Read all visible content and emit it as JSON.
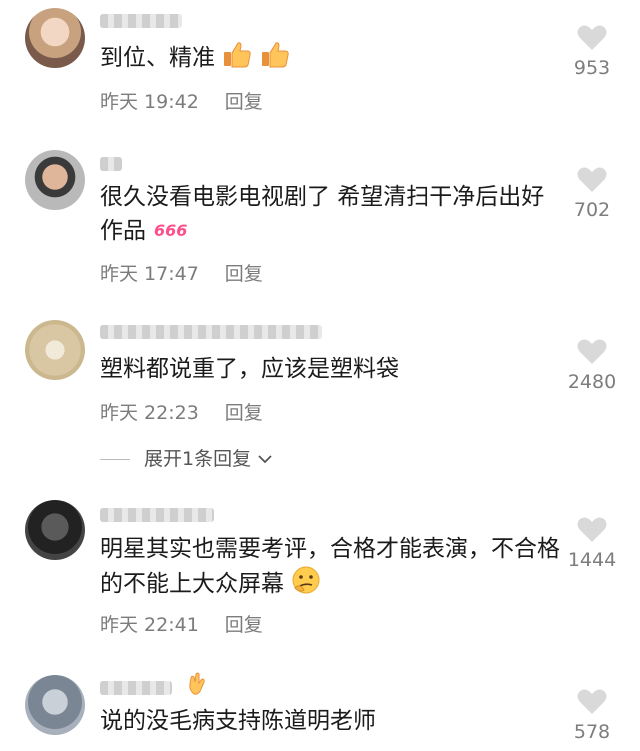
{
  "comments": [
    {
      "text": "到位、精准",
      "time": "昨天 19:42",
      "reply": "回复",
      "likes": "953"
    },
    {
      "text": "很久没看电影电视剧了 希望清扫干净后出好作品",
      "time": "昨天 17:47",
      "reply": "回复",
      "likes": "702"
    },
    {
      "text": "塑料都说重了，应该是塑料袋",
      "time": "昨天 22:23",
      "reply": "回复",
      "likes": "2480"
    },
    {
      "text": "明星其实也需要考评，合格才能表演，不合格的不能上大众屏幕",
      "time": "昨天 22:41",
      "reply": "回复",
      "likes": "1444"
    },
    {
      "text": "说的没毛病支持陈道明老师",
      "likes": "578"
    }
  ],
  "expand_replies": "展开1条回复",
  "icons": {
    "like": "heart-icon",
    "thumbs": "thumbs-up-icon",
    "six": "666-icon",
    "think": "thinking-face-icon",
    "chevron": "chevron-down-icon",
    "ok": "ok-hand-icon"
  },
  "colors": {
    "heart": "#d9d9d9",
    "meta": "#7c7c7c",
    "six": "#ff4f8b"
  }
}
